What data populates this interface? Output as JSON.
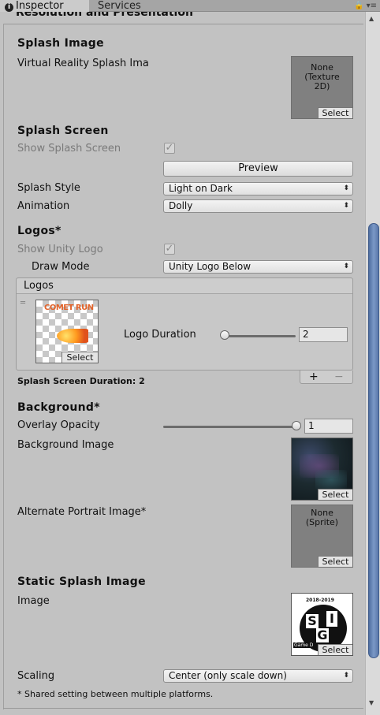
{
  "tabs": {
    "inspector": "Inspector",
    "services": "Services",
    "tools": "🔒 ▾≡"
  },
  "section_title": "Resolution and Presentation",
  "splash_image": {
    "heading": "Splash Image",
    "vr_label": "Virtual Reality Splash Ima",
    "vr_value": "None (Texture 2D)",
    "select": "Select"
  },
  "splash_screen": {
    "heading": "Splash Screen",
    "show_label": "Show Splash Screen",
    "show_checked": true,
    "preview": "Preview",
    "style_label": "Splash Style",
    "style_value": "Light on Dark",
    "animation_label": "Animation",
    "animation_value": "Dolly"
  },
  "logos": {
    "heading": "Logos*",
    "show_unity_label": "Show Unity Logo",
    "show_unity_checked": true,
    "draw_mode_label": "Draw Mode",
    "draw_mode_value": "Unity Logo Below",
    "list_header": "Logos",
    "item_text": "COMET RUN",
    "item_select": "Select",
    "duration_label": "Logo Duration",
    "duration_value": "2",
    "duration_fraction": 0.0,
    "add": "+",
    "remove": "−"
  },
  "total_duration": "Splash Screen Duration: 2",
  "background": {
    "heading": "Background*",
    "opacity_label": "Overlay Opacity",
    "opacity_value": "1",
    "opacity_fraction": 1.0,
    "image_label": "Background Image",
    "image_select": "Select",
    "alt_label": "Alternate Portrait Image*",
    "alt_value": "None (Sprite)",
    "alt_select": "Select"
  },
  "static_splash": {
    "heading": "Static Splash Image",
    "image_label": "Image",
    "image_top_text": "2018-2019",
    "image_letters": [
      "S",
      "I",
      "G"
    ],
    "image_bottom_text": "Game D",
    "image_select": "Select",
    "scaling_label": "Scaling",
    "scaling_value": "Center (only scale down)"
  },
  "footnote": "* Shared setting between multiple platforms."
}
